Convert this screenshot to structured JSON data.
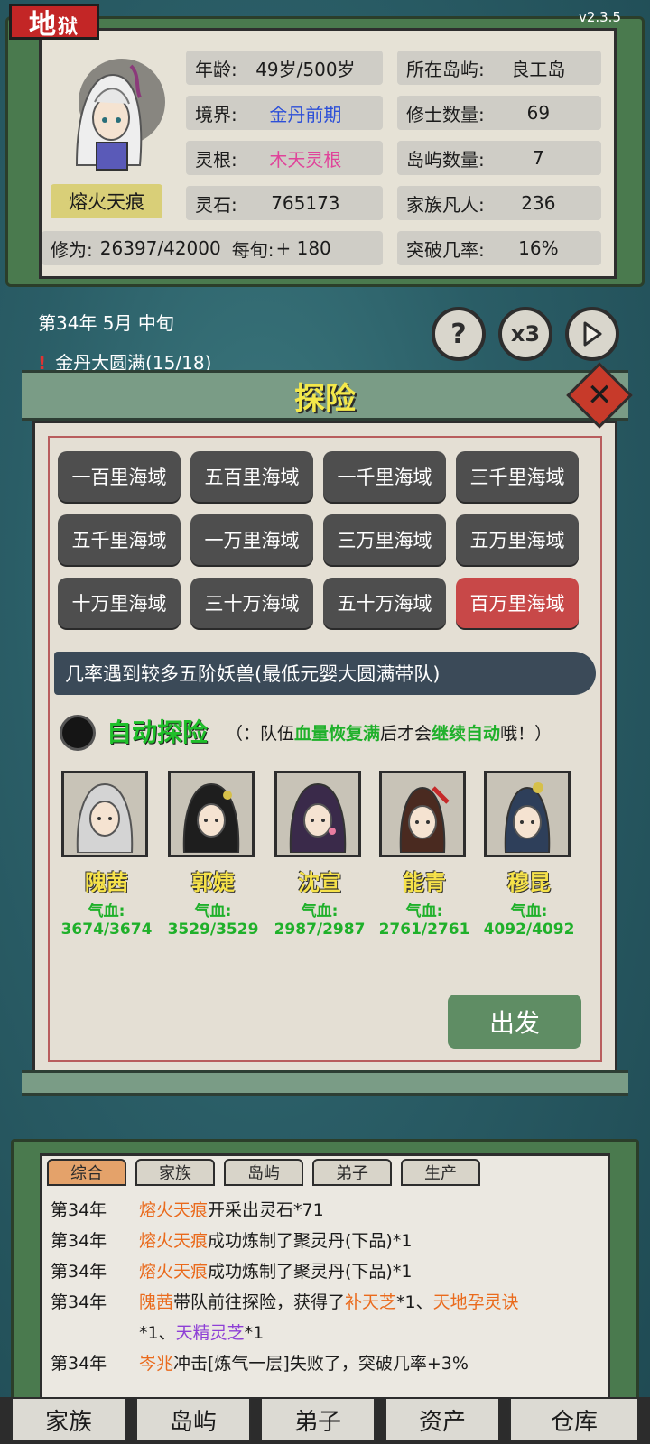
{
  "header": {
    "realm_badge_main": "地",
    "realm_badge_small": "狱",
    "version": "v2.3.5"
  },
  "profile": {
    "name": "熔火天痕",
    "age_label": "年龄:",
    "age_value": "49岁/500岁",
    "realm_label": "境界:",
    "realm_value": "金丹前期",
    "root_label": "灵根:",
    "root_value": "木天灵根",
    "stone_label": "灵石:",
    "stone_value": "765173",
    "cultivation_label": "修为:",
    "cultivation_value": "26397/42000",
    "per_turn_label": "每旬:",
    "per_turn_value": "+ 180",
    "island_label": "所在岛屿:",
    "island_value": "良工岛",
    "cultivators_label": "修士数量:",
    "cultivators_value": "69",
    "islands_label": "岛屿数量:",
    "islands_value": "7",
    "mortals_label": "家族凡人:",
    "mortals_value": "236",
    "breakthrough_label": "突破几率:",
    "breakthrough_value": "16%"
  },
  "time": {
    "date": "第34年 5月 中旬",
    "goal": "金丹大圆满(15/18)",
    "speed_label": "x3",
    "help_label": "?"
  },
  "explore": {
    "title": "探险",
    "close_label": "✕",
    "areas": [
      {
        "label": "一百里海域"
      },
      {
        "label": "五百里海域"
      },
      {
        "label": "一千里海域"
      },
      {
        "label": "三千里海域"
      },
      {
        "label": "五千里海域"
      },
      {
        "label": "一万里海域"
      },
      {
        "label": "三万里海域"
      },
      {
        "label": "五万里海域"
      },
      {
        "label": "十万里海域"
      },
      {
        "label": "三十万海域"
      },
      {
        "label": "五十万海域"
      },
      {
        "label": "百万里海域"
      }
    ],
    "selected_area": "百万里海域",
    "description": "几率遇到较多五阶妖兽(最低元婴大圆满带队)",
    "auto_label": "自动探险",
    "auto_note_parts": {
      "p1": "（：队伍",
      "p2": "血量恢复满",
      "p3": "后才会",
      "p4": "继续自动",
      "p5": "哦！）"
    },
    "team": [
      {
        "name": "隗茜",
        "hp_label": "气血:",
        "hp": "3674/3674"
      },
      {
        "name": "郭婕",
        "hp_label": "气血:",
        "hp": "3529/3529"
      },
      {
        "name": "沈宣",
        "hp_label": "气血:",
        "hp": "2987/2987"
      },
      {
        "name": "能青",
        "hp_label": "气血:",
        "hp": "2761/2761"
      },
      {
        "name": "穆昆",
        "hp_label": "气血:",
        "hp": "4092/4092"
      }
    ],
    "go_label": "出发"
  },
  "log": {
    "tabs": [
      {
        "label": "综合"
      },
      {
        "label": "家族"
      },
      {
        "label": "岛屿"
      },
      {
        "label": "弟子"
      },
      {
        "label": "生产"
      }
    ],
    "entries": {
      "e1": {
        "year": "第34年",
        "who": "熔火天痕",
        "text": "开采出灵石*71"
      },
      "e2": {
        "year": "第34年",
        "who": "熔火天痕",
        "text": "成功炼制了聚灵丹(下品)*1"
      },
      "e3": {
        "year": "第34年",
        "who": "熔火天痕",
        "text": "成功炼制了聚灵丹(下品)*1"
      },
      "e4": {
        "year": "第34年",
        "who": "隗茜",
        "text": "带队前往探险，获得了",
        "item1": "补天芝",
        "t2": "*1、",
        "item2": "天地孕灵诀",
        "t3": "*1、",
        "item3": "天精灵芝",
        "t4": "*1"
      },
      "e5": {
        "year": "第34年",
        "who": "岑兆",
        "text": "冲击[炼气一层]失败了，突破几率+3%"
      }
    }
  },
  "nav": {
    "items": [
      {
        "label": "家族"
      },
      {
        "label": "岛屿"
      },
      {
        "label": "弟子"
      },
      {
        "label": "资产"
      },
      {
        "label": "仓库"
      }
    ]
  }
}
